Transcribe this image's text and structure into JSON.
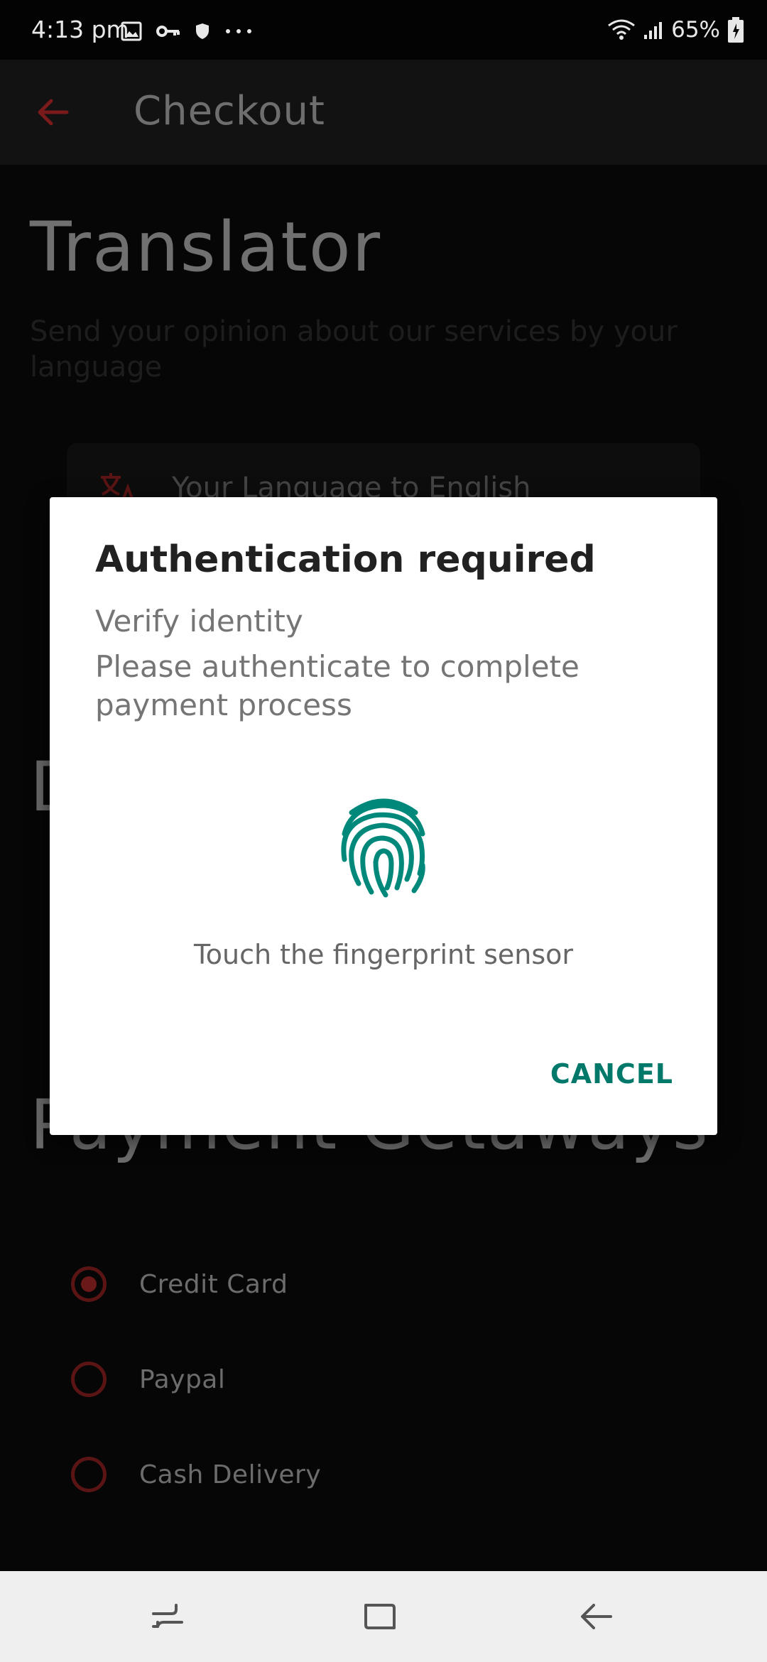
{
  "status_bar": {
    "time": "4:13 pm",
    "battery": "65%"
  },
  "app_bar": {
    "title": "Checkout"
  },
  "background": {
    "heading": "Translator",
    "subtitle": "Send your opinion about our services by your language",
    "card_label": "Your Language to English",
    "partial_heading": "D",
    "payments_heading": "Payment Getaways",
    "payment_options": [
      {
        "label": "Credit Card",
        "selected": true
      },
      {
        "label": "Paypal",
        "selected": false
      },
      {
        "label": "Cash Delivery",
        "selected": false
      }
    ]
  },
  "dialog": {
    "title": "Authentication required",
    "subtitle": "Verify identity",
    "description": "Please authenticate to complete payment process",
    "hint": "Touch the fingerprint sensor",
    "cancel_label": "CANCEL",
    "accent_color": "#00897b"
  },
  "colors": {
    "primary_red": "#8b1e1e",
    "accent_teal": "#00796b"
  }
}
